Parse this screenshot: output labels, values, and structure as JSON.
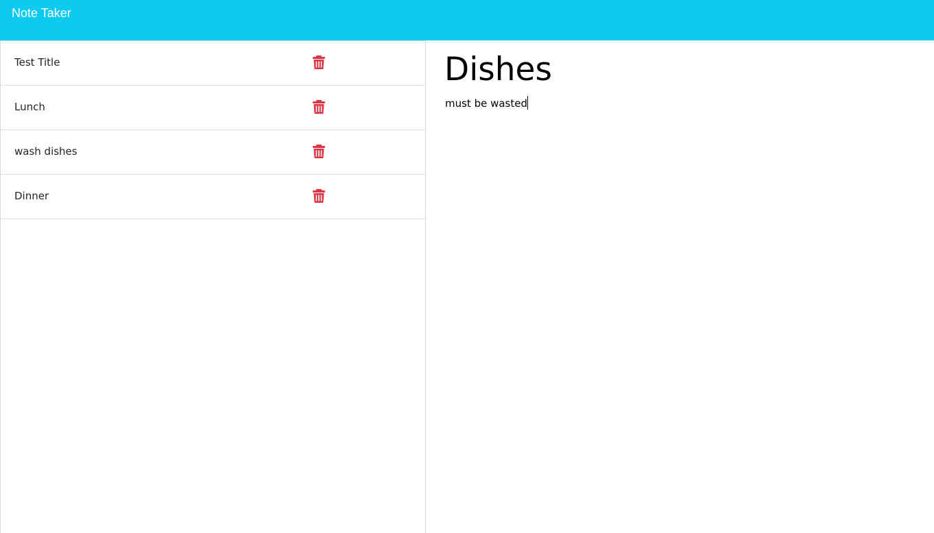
{
  "app": {
    "brand": "Note Taker",
    "accent_color": "#0dcaf0",
    "delete_color": "#dc3545"
  },
  "notes": [
    {
      "title": "Test Title",
      "icon": "trash-icon"
    },
    {
      "title": "Lunch",
      "icon": "trash-icon"
    },
    {
      "title": "wash dishes",
      "icon": "trash-icon"
    },
    {
      "title": "Dinner",
      "icon": "trash-icon"
    }
  ],
  "editor": {
    "title_value": "Dishes",
    "body_value": "must be wasted"
  }
}
